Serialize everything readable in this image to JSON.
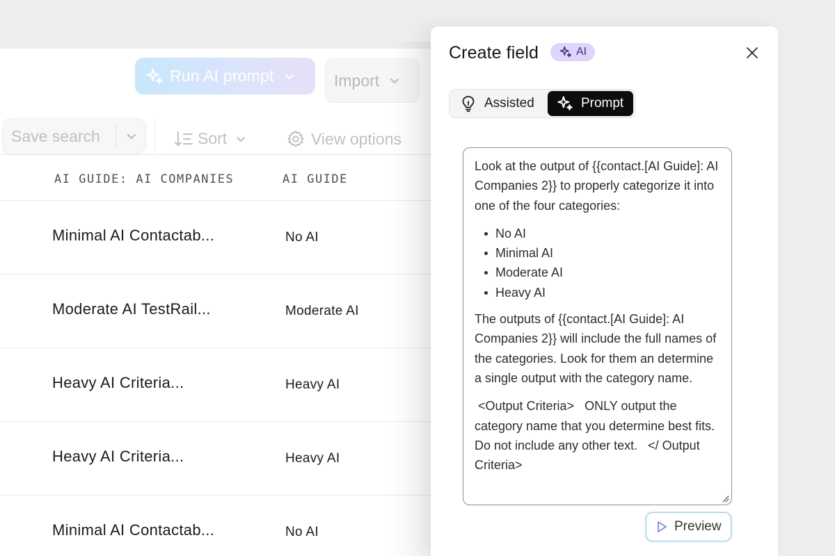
{
  "toolbar": {
    "run_ai_label": "Run AI prompt",
    "import_label": "Import",
    "save_search_label": "Save search",
    "sort_label": "Sort",
    "view_options_label": "View options"
  },
  "table": {
    "columns": [
      "AI GUIDE: AI COMPANIES",
      "AI GUIDE"
    ],
    "rows": [
      {
        "company": "Minimal AI Contactab...",
        "guide": "No AI"
      },
      {
        "company": "Moderate AI TestRail...",
        "guide": "Moderate AI"
      },
      {
        "company": "Heavy AI Criteria...",
        "guide": "Heavy AI"
      },
      {
        "company": "Heavy AI Criteria...",
        "guide": "Heavy AI"
      },
      {
        "company": "Minimal AI Contactab...",
        "guide": "No AI"
      }
    ]
  },
  "drawer": {
    "title": "Create field",
    "badge": "AI",
    "tabs": {
      "assisted": "Assisted",
      "prompt": "Prompt",
      "active": "prompt"
    },
    "prompt": {
      "intro": "Look at the output of {{contact.[AI Guide]: AI Companies 2}} to properly categorize it into one of the four categories:",
      "categories": [
        "No AI",
        "Minimal AI",
        "Moderate AI",
        "Heavy AI"
      ],
      "body": "The outputs of {{contact.[AI Guide]: AI Companies 2}} will include the full names of the categories. Look for them an determine a single output with the category name.",
      "criteria": " <Output Criteria>   ONLY output the category name that you determine best fits. Do not include any other text.   </ Output Criteria>"
    },
    "preview_label": "Preview"
  },
  "colors": {
    "accent_black": "#0c0c0c",
    "ai_badge_bg": "#dfd4fb",
    "run_ai_gradient": [
      "#c6e6fb",
      "#e6defa"
    ],
    "preview_border": "#8fcfe0"
  }
}
